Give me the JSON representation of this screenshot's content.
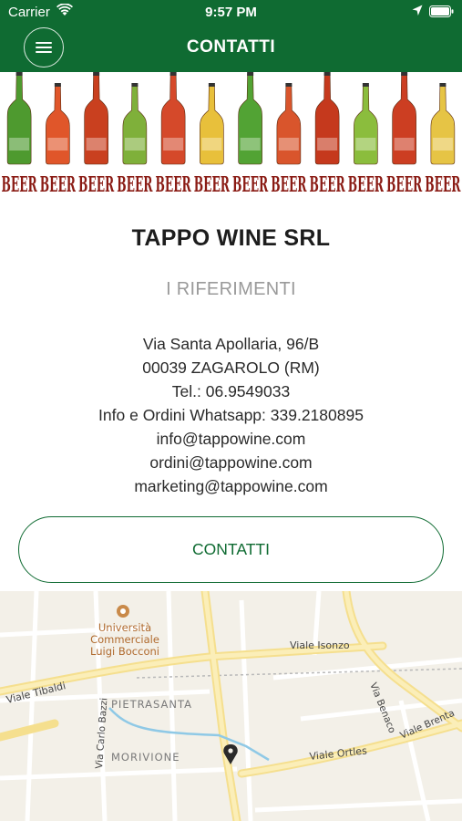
{
  "status_bar": {
    "carrier": "Carrier",
    "time": "9:57 PM"
  },
  "nav": {
    "title": "CONTATTI",
    "menu_icon": "hamburger-icon"
  },
  "banner": {
    "word": "BEER",
    "bottle_colors": [
      "#4e9a2f",
      "#e0562a",
      "#c9401f",
      "#7fb03a",
      "#d5492a",
      "#e8c03b",
      "#52a334",
      "#d9552c",
      "#c5391d",
      "#8bbd3d",
      "#cc3e22",
      "#e6c445"
    ]
  },
  "company": {
    "name": "TAPPO WINE SRL",
    "subtitle": "I RIFERIMENTI"
  },
  "info": {
    "address_line1": "Via Santa Apollaria, 96/B",
    "address_line2": "00039 ZAGAROLO (RM)",
    "phone": "Tel.: 06.9549033",
    "whatsapp": "Info e Ordini Whatsapp: 339.2180895",
    "email_info": "info@tappowine.com",
    "email_orders": "ordini@tappowine.com",
    "email_marketing": "marketing@tappowine.com"
  },
  "contact_button": {
    "label": "CONTATTI"
  },
  "map": {
    "labels": {
      "university_line1": "Università",
      "university_line2": "Commerciale",
      "university_line3": "Luigi Bocconi",
      "viale_isonzo": "Viale Isonzo",
      "viale_tibaldi": "Viale Tibaldi",
      "pietrasanta": "PIETRASANTA",
      "via_benaco": "Via Benaco",
      "viale_brenta": "Viale Brenta",
      "via_carlo_bazzi": "Via Carlo Bazzi",
      "morivione": "MORIVIONE",
      "viale_ortles": "Viale Ortles"
    },
    "pin_icon": "map-pin-icon"
  },
  "colors": {
    "brand_green": "#0f6b32",
    "map_background": "#f3f0e8",
    "road_yellow": "#f7e59c"
  }
}
